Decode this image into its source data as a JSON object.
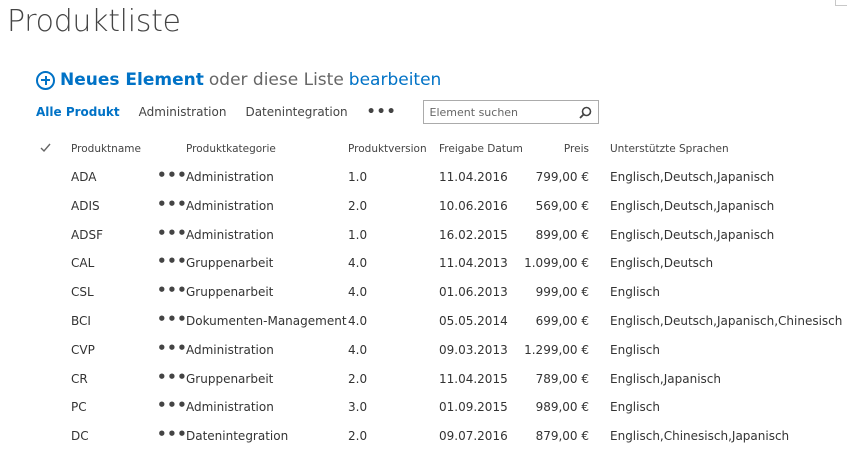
{
  "page": {
    "title": "Produktliste"
  },
  "toolbar": {
    "new_item": "Neues Element",
    "or_text": "oder diese Liste",
    "edit": "bearbeiten"
  },
  "views": {
    "tabs": [
      "Alle Produkt",
      "Administration",
      "Datenintegration"
    ],
    "more": "•••",
    "search_placeholder": "Element suchen"
  },
  "table": {
    "headers": {
      "name": "Produktname",
      "category": "Produktkategorie",
      "version": "Produktversion",
      "date": "Freigabe Datum",
      "price": "Preis",
      "languages": "Unterstützte Sprachen"
    },
    "row_menu": "•••",
    "rows": [
      {
        "name": "ADA",
        "category": "Administration",
        "version": "1.0",
        "date": "11.04.2016",
        "price": "799,00 €",
        "languages": "Englisch,Deutsch,Japanisch"
      },
      {
        "name": "ADIS",
        "category": "Administration",
        "version": "2.0",
        "date": "10.06.2016",
        "price": "569,00 €",
        "languages": "Englisch,Deutsch,Japanisch"
      },
      {
        "name": "ADSF",
        "category": "Administration",
        "version": "1.0",
        "date": "16.02.2015",
        "price": "899,00 €",
        "languages": "Englisch,Deutsch,Japanisch"
      },
      {
        "name": "CAL",
        "category": "Gruppenarbeit",
        "version": "4.0",
        "date": "11.04.2013",
        "price": "1.099,00 €",
        "languages": "Englisch,Deutsch"
      },
      {
        "name": "CSL",
        "category": "Gruppenarbeit",
        "version": "4.0",
        "date": "01.06.2013",
        "price": "999,00 €",
        "languages": "Englisch"
      },
      {
        "name": "BCI",
        "category": "Dokumenten-Management",
        "version": "4.0",
        "date": "05.05.2014",
        "price": "699,00 €",
        "languages": "Englisch,Deutsch,Japanisch,Chinesisch"
      },
      {
        "name": "CVP",
        "category": "Administration",
        "version": "4.0",
        "date": "09.03.2013",
        "price": "1.299,00 €",
        "languages": "Englisch"
      },
      {
        "name": "CR",
        "category": "Gruppenarbeit",
        "version": "2.0",
        "date": "11.04.2015",
        "price": "789,00 €",
        "languages": "Englisch,Japanisch"
      },
      {
        "name": "PC",
        "category": "Administration",
        "version": "3.0",
        "date": "01.09.2015",
        "price": "989,00 €",
        "languages": "Englisch"
      },
      {
        "name": "DC",
        "category": "Datenintegration",
        "version": "2.0",
        "date": "09.07.2016",
        "price": "879,00 €",
        "languages": "Englisch,Chinesisch,Japanisch"
      }
    ]
  },
  "colors": {
    "accent": "#0072c6",
    "text": "#333333"
  },
  "icons": {
    "new_item": "plus-circle-icon",
    "search": "search-icon",
    "select_all": "checkmark-icon"
  }
}
